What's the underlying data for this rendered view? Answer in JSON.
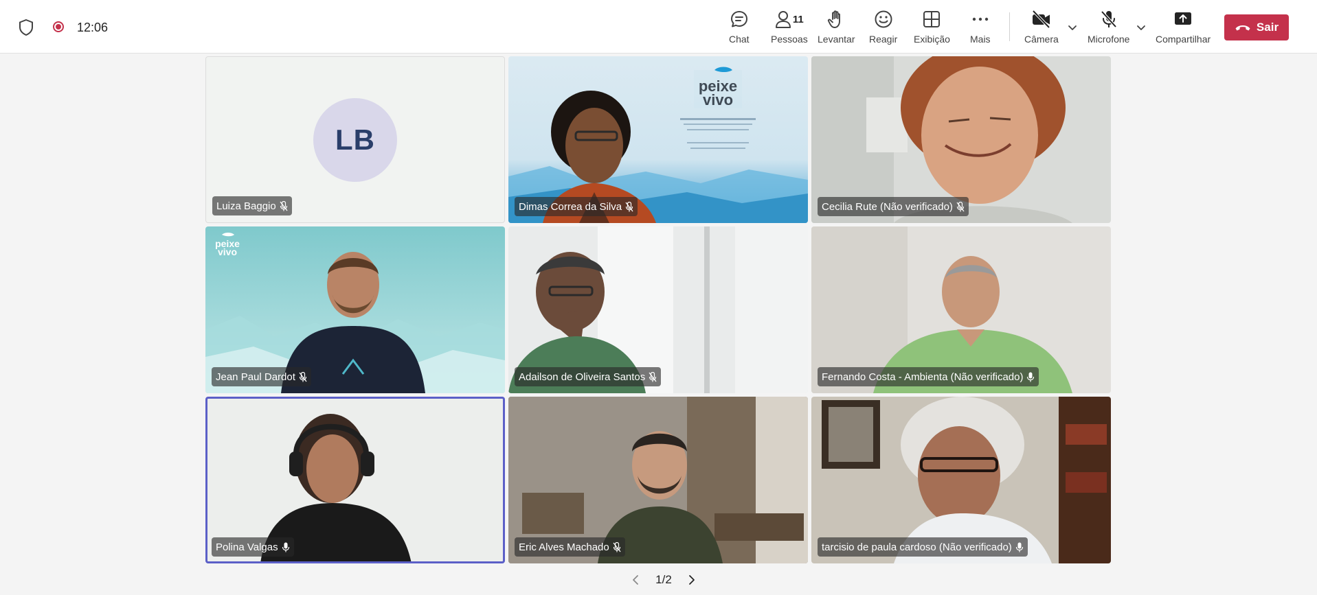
{
  "header": {
    "time": "12:06",
    "participant_count": "11"
  },
  "toolbar": {
    "chat": "Chat",
    "people": "Pessoas",
    "raise": "Levantar",
    "react": "Reagir",
    "view": "Exibição",
    "more": "Mais",
    "camera": "Câmera",
    "mic": "Microfone",
    "share": "Compartilhar",
    "leave": "Sair"
  },
  "participants": [
    {
      "name": "Luiza Baggio",
      "initials": "LB",
      "muted": true
    },
    {
      "name": "Dimas Correa da Silva",
      "muted": true
    },
    {
      "name": "Cecilia Rute (Não verificado)",
      "muted": true
    },
    {
      "name": "Jean Paul Dardot",
      "muted": true
    },
    {
      "name": "Adailson de Oliveira Santos",
      "muted": true
    },
    {
      "name": "Fernando Costa - Ambienta (Não verificado)",
      "muted": false
    },
    {
      "name": "Polina Valgas",
      "muted": false,
      "speaking": true
    },
    {
      "name": "Eric Alves Machado",
      "muted": true
    },
    {
      "name": "tarcisio de paula cardoso (Não verificado)",
      "muted": false
    }
  ],
  "pager": {
    "label": "1/2"
  },
  "colors": {
    "accent": "#5b5fc7",
    "leave": "#c4314b",
    "recording": "#c4314b"
  }
}
